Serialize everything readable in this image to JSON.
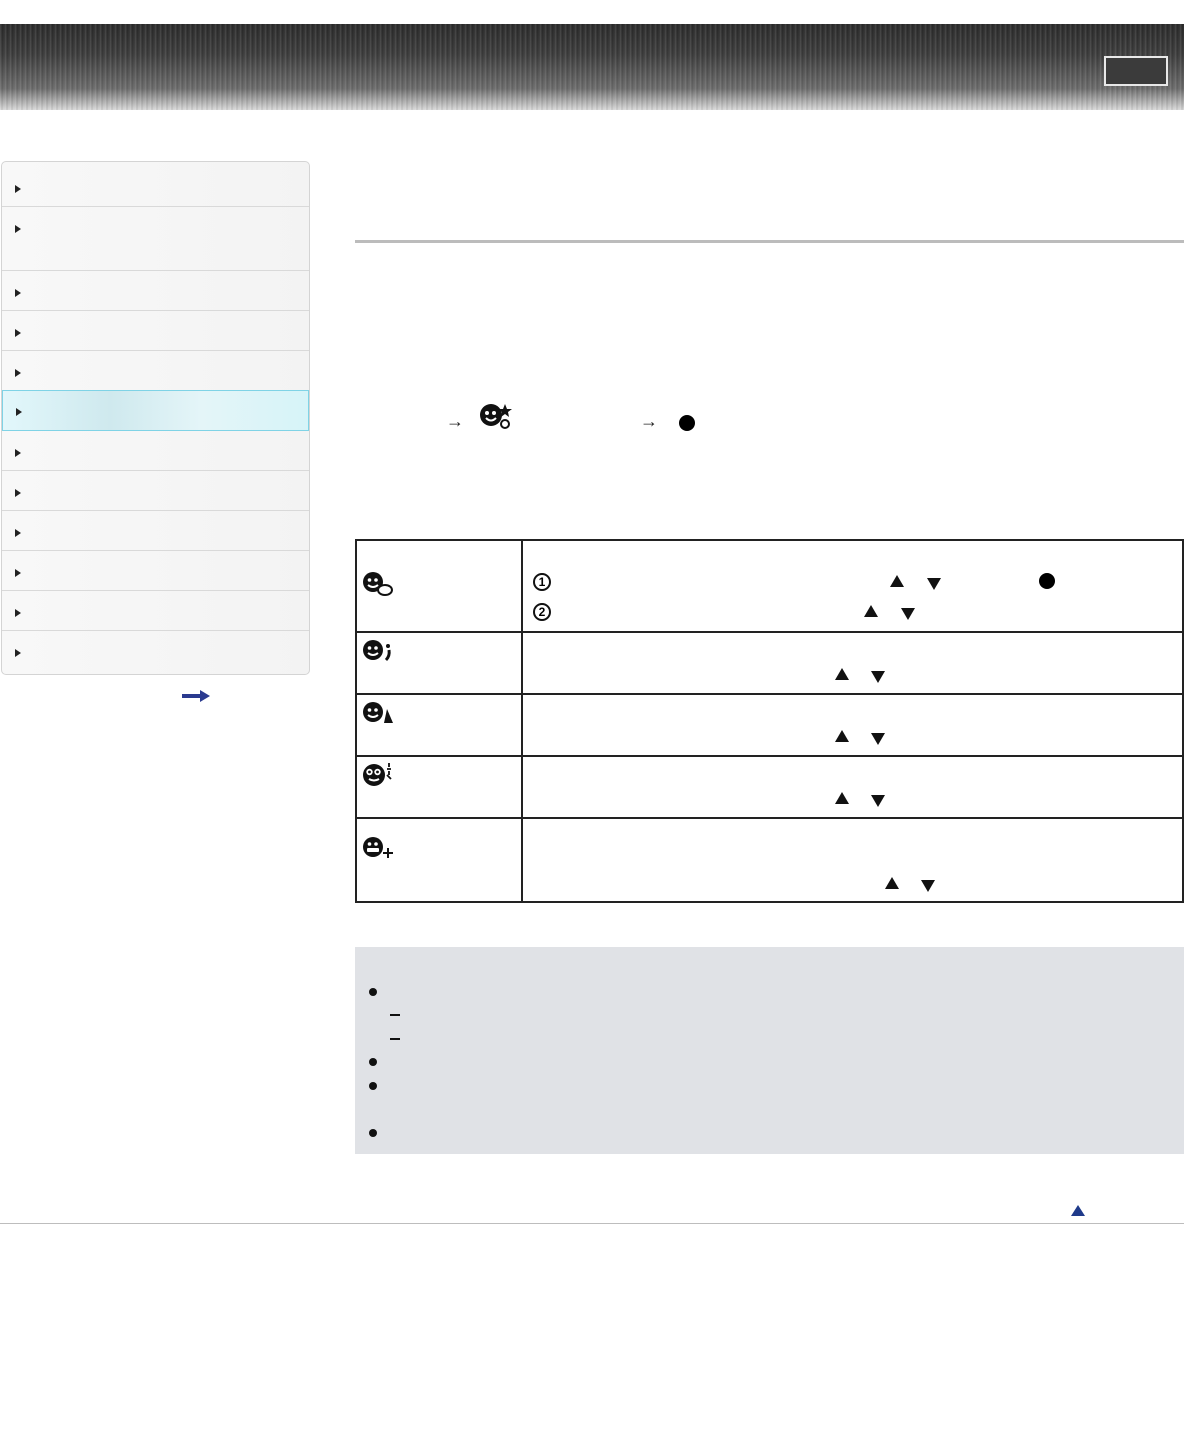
{
  "header": {
    "button_label": ""
  },
  "sidebar": {
    "items": [
      {
        "label": ""
      },
      {
        "label": ""
      },
      {
        "label": ""
      },
      {
        "label": ""
      },
      {
        "label": ""
      },
      {
        "label": "",
        "selected": true
      },
      {
        "label": ""
      },
      {
        "label": ""
      },
      {
        "label": ""
      },
      {
        "label": ""
      },
      {
        "label": ""
      },
      {
        "label": ""
      }
    ],
    "more_link": ""
  },
  "table": {
    "rows": [
      {
        "name": "soft-skin-effect",
        "icon": "face-soft-skin-icon"
      },
      {
        "name": "skin-glow",
        "icon": "face-shine-icon"
      },
      {
        "name": "face-slim",
        "icon": "face-slim-icon"
      },
      {
        "name": "eye-enlarge",
        "icon": "face-eyes-icon"
      },
      {
        "name": "teeth-whitening",
        "icon": "face-teeth-icon"
      }
    ]
  },
  "colors": {
    "selected_nav": "#d6f4f8",
    "notes_bg": "#e0e2e6",
    "top_link": "#1f3a8a"
  }
}
